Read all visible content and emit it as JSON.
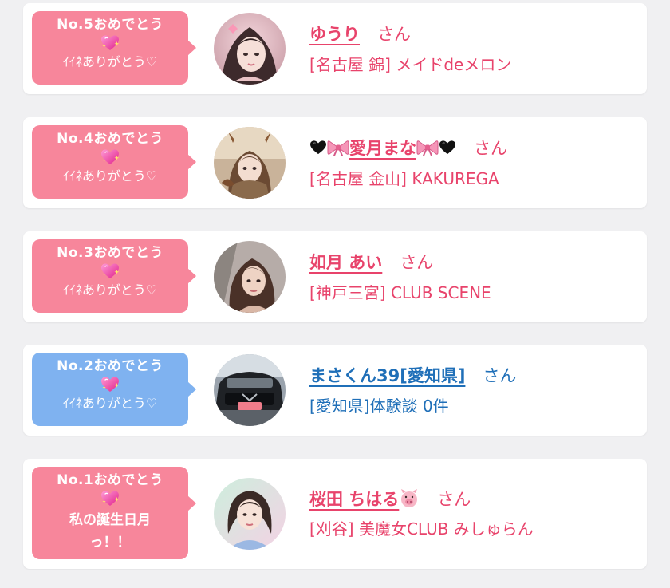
{
  "colors": {
    "pink_bubble": "#f7869b",
    "blue_bubble": "#7fb2f0",
    "pink_text": "#e8436b",
    "blue_text": "#1f6fb8"
  },
  "cards": [
    {
      "rank": "No.5おめでとう",
      "heart_icon": "sparkling-heart-icon",
      "message": "ｲｲﾈありがとう♡",
      "name": "ゆうり",
      "suffix": "さん",
      "shop": "[名古屋 錦] メイドdeメロン",
      "color": "pink"
    },
    {
      "rank": "No.4おめでとう",
      "heart_icon": "sparkling-heart-icon",
      "message": "ｲｲﾈありがとう♡",
      "name_prefix_icons": [
        "black-heart-icon",
        "ribbon-icon"
      ],
      "name": "愛月まな",
      "name_suffix_icons": [
        "ribbon-icon",
        "black-heart-icon"
      ],
      "suffix": "さん",
      "shop": "[名古屋 金山] KAKUREGA",
      "color": "pink"
    },
    {
      "rank": "No.3おめでとう",
      "heart_icon": "sparkling-heart-icon",
      "message": "ｲｲﾈありがとう♡",
      "name": "如月 あい",
      "suffix": "さん",
      "shop": "[神戸三宮] CLUB SCENE",
      "color": "pink"
    },
    {
      "rank": "No.2おめでとう",
      "heart_icon": "sparkling-heart-icon",
      "message": "ｲｲﾈありがとう♡",
      "name": "まさくん39[愛知県]",
      "suffix": "さん",
      "shop": "[愛知県]体験談 0件",
      "color": "blue"
    },
    {
      "rank": "No.1おめでとう",
      "heart_icon": "sparkling-heart-icon",
      "message_line1": "私の誕生日月",
      "message_line2": "っ！！",
      "name": "桜田 ちはる",
      "name_suffix_icons": [
        "pig-icon"
      ],
      "suffix": "さん",
      "shop": "[刈谷] 美魔女CLUB みしゅらん",
      "color": "pink"
    }
  ]
}
